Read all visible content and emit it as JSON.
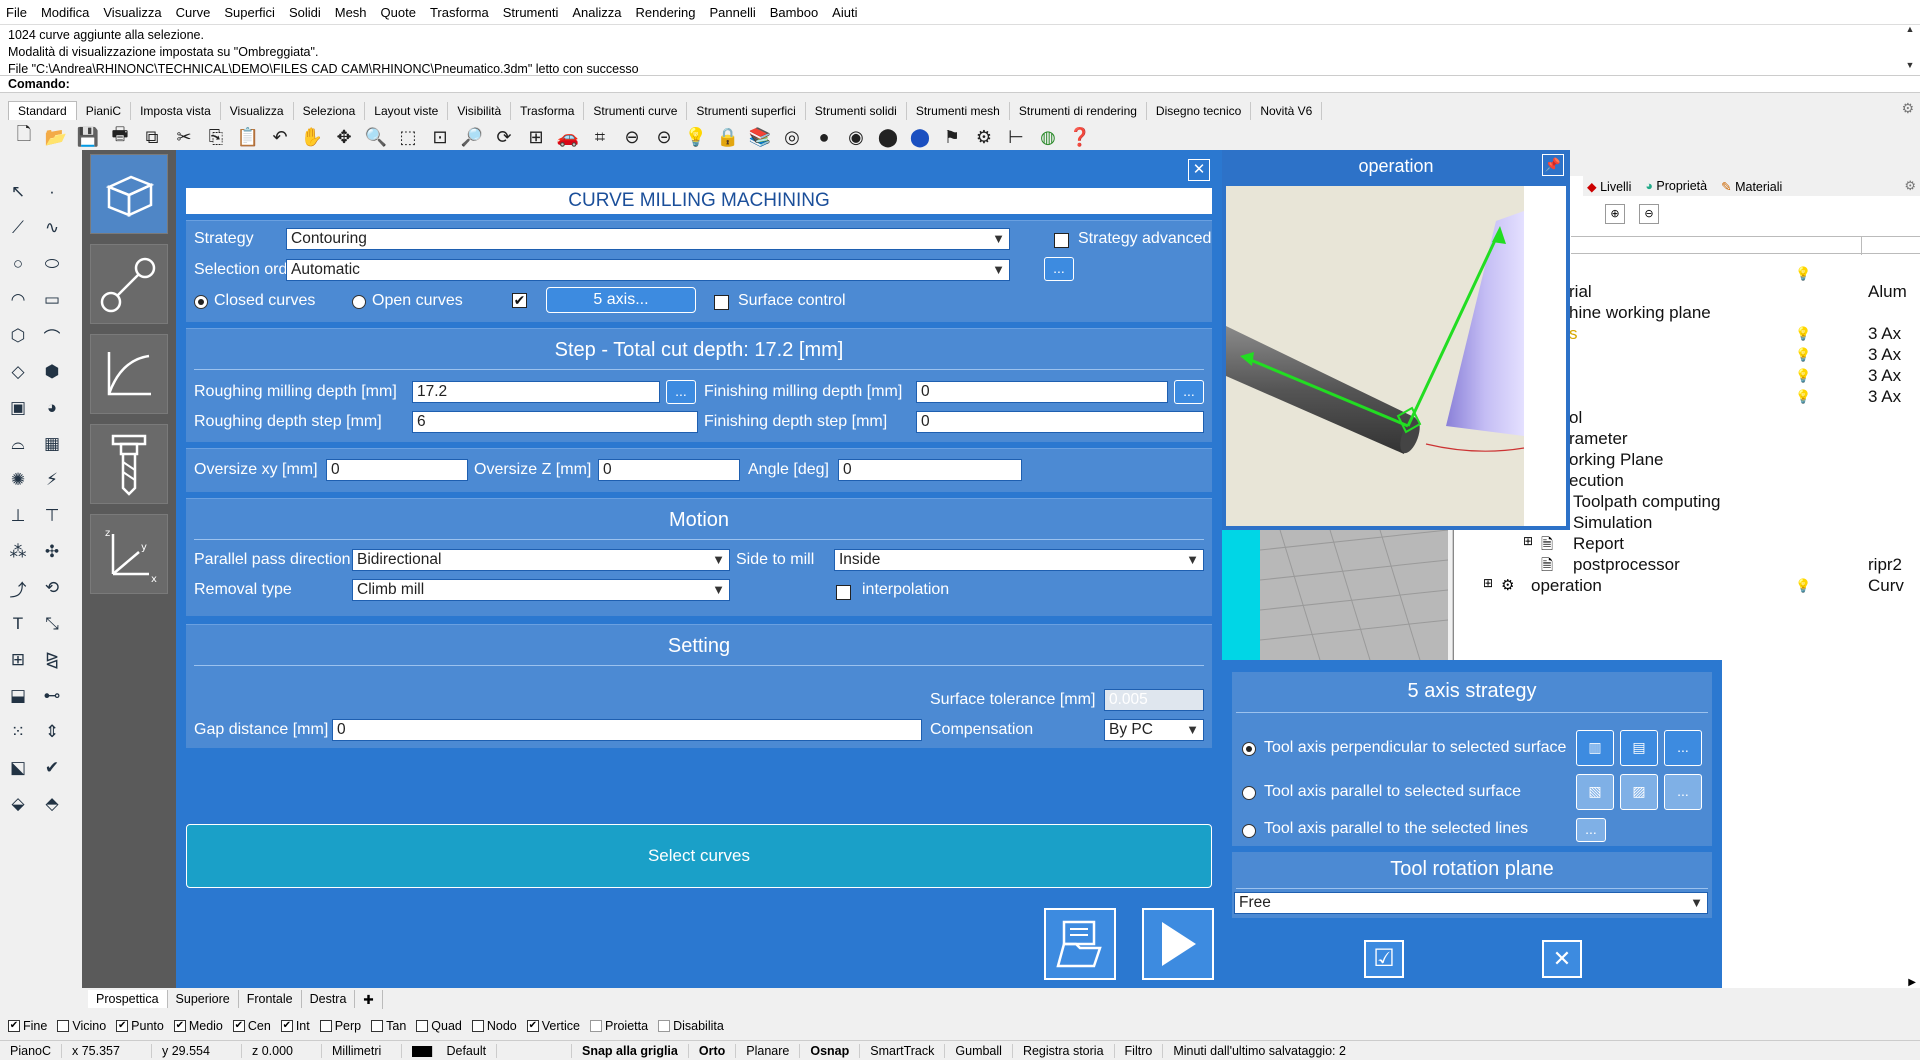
{
  "menu": [
    "File",
    "Modifica",
    "Visualizza",
    "Curve",
    "Superfici",
    "Solidi",
    "Mesh",
    "Quote",
    "Trasforma",
    "Strumenti",
    "Analizza",
    "Rendering",
    "Pannelli",
    "Bamboo",
    "Aiuti"
  ],
  "history": [
    "1024 curve aggiunte alla selezione.",
    "Modalità di visualizzazione impostata su \"Ombreggiata\".",
    "File \"C:\\Andrea\\RHINONC\\TECHNICAL\\DEMO\\FILES CAD CAM\\RHINONC\\Pneumatico.3dm\" letto con successo"
  ],
  "command_label": "Comando:",
  "toolbar_tabs": [
    "Standard",
    "PianiC",
    "Imposta vista",
    "Visualizza",
    "Seleziona",
    "Layout viste",
    "Visibilità",
    "Trasforma",
    "Strumenti curve",
    "Strumenti superfici",
    "Strumenti solidi",
    "Strumenti mesh",
    "Strumenti di rendering",
    "Disegno tecnico",
    "Novità V6"
  ],
  "main": {
    "title": "CURVE MILLING MACHINING",
    "strategy_label": "Strategy",
    "strategy_value": "Contouring",
    "strategy_advanced_label": "Strategy advanced",
    "selection_order_label": "Selection order",
    "selection_order_value": "Automatic",
    "dots": "...",
    "closed_curves_label": "Closed curves",
    "open_curves_label": "Open curves",
    "five_axis_button": "5 axis...",
    "surface_control_label": "Surface control",
    "step_title": "Step - Total cut depth: 17.2 [mm]",
    "roughing_depth_label": "Roughing milling depth [mm]",
    "roughing_depth_value": "17.2",
    "finishing_depth_label": "Finishing milling depth [mm]",
    "finishing_depth_value": "0",
    "roughing_step_label": "Roughing depth step [mm]",
    "roughing_step_value": "6",
    "finishing_step_label": "Finishing depth step [mm]",
    "finishing_step_value": "0",
    "oversize_xy_label": "Oversize xy [mm]",
    "oversize_xy_value": "0",
    "oversize_z_label": "Oversize Z [mm]",
    "oversize_z_value": "0",
    "angle_label": "Angle [deg]",
    "angle_value": "0",
    "motion_title": "Motion",
    "parallel_pass_label": "Parallel pass direction",
    "parallel_pass_value": "Bidirectional",
    "side_to_mill_label": "Side to mill",
    "side_to_mill_value": "Inside",
    "removal_type_label": "Removal type",
    "removal_type_value": "Climb mill",
    "interpolation_label": "interpolation",
    "setting_title": "Setting",
    "surface_tolerance_label": "Surface tolerance [mm]",
    "surface_tolerance_value": "0.005",
    "gap_distance_label": "Gap distance [mm]",
    "gap_distance_value": "0",
    "compensation_label": "Compensation",
    "compensation_value": "By PC",
    "select_curves_button": "Select curves"
  },
  "operation": {
    "title": "operation"
  },
  "axis5": {
    "title": "5 axis strategy",
    "option1": "Tool axis perpendicular to selected surface",
    "option2": "Tool axis parallel to selected surface",
    "option3": "Tool axis parallel to the selected lines",
    "dots": "...",
    "rotation_title": "Tool rotation plane",
    "rotation_value": "Free"
  },
  "right_panel": {
    "tabs": [
      "Livelli",
      "Proprietà",
      "Materiali"
    ],
    "tree": [
      {
        "text": "rial",
        "value": "Alum"
      },
      {
        "text": "hine working plane",
        "value": ""
      },
      {
        "text": "s",
        "value": "3 Ax"
      },
      {
        "text": "",
        "value": "3 Ax"
      },
      {
        "text": "",
        "value": "3 Ax"
      },
      {
        "text": "",
        "value": "3 Ax"
      },
      {
        "text": "ol",
        "value": ""
      },
      {
        "text": "rameter",
        "value": ""
      },
      {
        "text": "orking Plane",
        "value": ""
      },
      {
        "text": "ecution",
        "value": ""
      },
      {
        "text": "Toolpath computing",
        "value": ""
      },
      {
        "text": "Simulation",
        "value": ""
      },
      {
        "text": "Report",
        "value": ""
      },
      {
        "text": "postprocessor",
        "value": "ripr2"
      },
      {
        "text": "operation",
        "value": "Curv"
      }
    ]
  },
  "view_tabs": [
    "Prospettica",
    "Superiore",
    "Frontale",
    "Destra"
  ],
  "osnap": [
    {
      "label": "Fine",
      "on": true
    },
    {
      "label": "Vicino",
      "on": false
    },
    {
      "label": "Punto",
      "on": true
    },
    {
      "label": "Medio",
      "on": true
    },
    {
      "label": "Cen",
      "on": true
    },
    {
      "label": "Int",
      "on": true
    },
    {
      "label": "Perp",
      "on": false
    },
    {
      "label": "Tan",
      "on": false
    },
    {
      "label": "Quad",
      "on": false
    },
    {
      "label": "Nodo",
      "on": false
    },
    {
      "label": "Vertice",
      "on": true
    },
    {
      "label": "Proietta",
      "on": false
    },
    {
      "label": "Disabilita",
      "on": false
    }
  ],
  "status": {
    "plane": "PianoC",
    "x": "x 75.357",
    "y": "y 29.554",
    "z": "z 0.000",
    "units": "Millimetri",
    "layer": "Default",
    "snap": "Snap alla griglia",
    "orto": "Orto",
    "planare": "Planare",
    "osnap": "Osnap",
    "smarttrack": "SmartTrack",
    "gumball": "Gumball",
    "history": "Registra storia",
    "filter": "Filtro",
    "saved": "Minuti dall'ultimo salvataggio: 2"
  },
  "colors": {
    "panel_blue": "#2b78d0",
    "section_blue": "#4c8ad3",
    "title_text": "#1b4f9a"
  }
}
